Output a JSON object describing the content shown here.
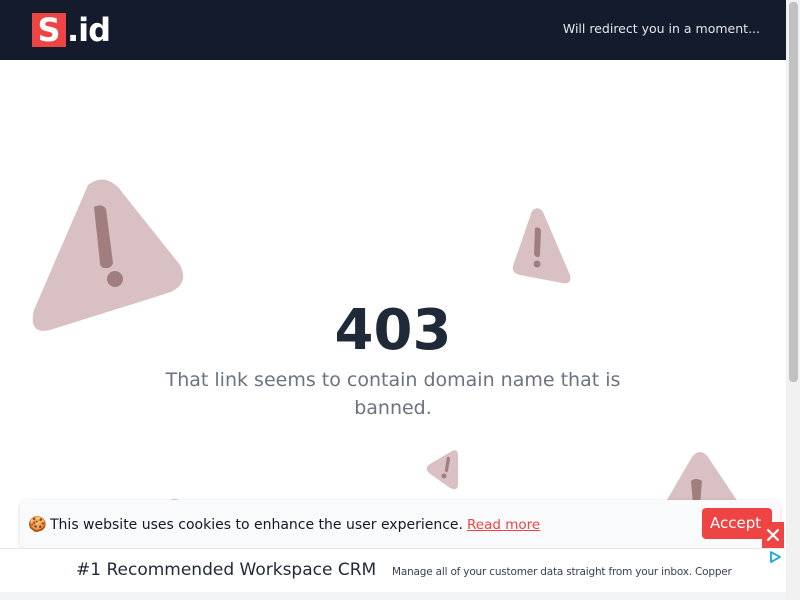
{
  "header": {
    "logo_s": "S",
    "logo_rest": ".id",
    "redirect_text": "Will redirect you in a moment..."
  },
  "main": {
    "error_code": "403",
    "message": "That link seems to contain domain name that is banned."
  },
  "cookie_banner": {
    "icon": "🍪",
    "text": "This website uses cookies to enhance the user experience.",
    "read_more": "Read more",
    "accept": "Accept"
  },
  "ad": {
    "headline": "#1 Recommended Workspace CRM",
    "description": "Manage all of your customer data straight from your inbox. Copper",
    "close_icon": "close-icon",
    "adchoices_icon": "adchoices-icon"
  },
  "colors": {
    "header_bg": "#141b2d",
    "accent": "#ef4444",
    "warning_triangle": "#d9c1c3",
    "warning_mark": "#a07e80",
    "code_text": "#1f2937",
    "message_text": "#6b7280"
  }
}
